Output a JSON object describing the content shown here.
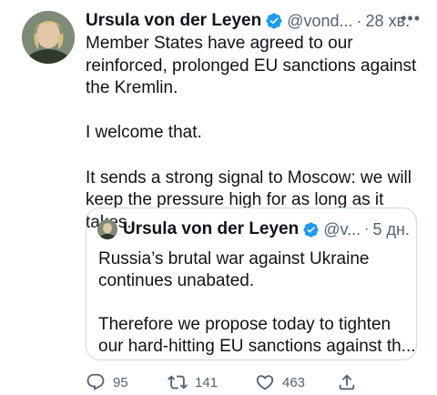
{
  "tweet": {
    "author_name": "Ursula von der Leyen",
    "handle": "@vond...",
    "separator": "·",
    "time": "28 хв.",
    "more_icon": "more-horizontal-icon",
    "body": [
      "Member States have agreed to our",
      "reinforced, prolonged EU sanctions against",
      "the Kremlin.",
      "",
      "I welcome that.",
      "",
      "It sends a strong signal to Moscow: we will",
      "keep the pressure high for as long as it takes."
    ]
  },
  "quote": {
    "author_name": "Ursula von der Leyen",
    "handle": "@v...",
    "separator": "·",
    "time": "5 дн.",
    "body": [
      "Russia’s brutal war against Ukraine",
      "continues unabated.",
      "",
      "Therefore we propose today to tighten",
      "our hard-hitting EU sanctions against th..."
    ]
  },
  "actions": {
    "reply": {
      "icon": "reply-icon",
      "count": "95"
    },
    "retweet": {
      "icon": "retweet-icon",
      "count": "141"
    },
    "like": {
      "icon": "heart-icon",
      "count": "463"
    },
    "share": {
      "icon": "share-icon",
      "count": ""
    }
  },
  "colors": {
    "verified": "#1d9bf0",
    "secondary_text": "#536471",
    "border": "#cfd9de",
    "text": "#0f1419"
  }
}
